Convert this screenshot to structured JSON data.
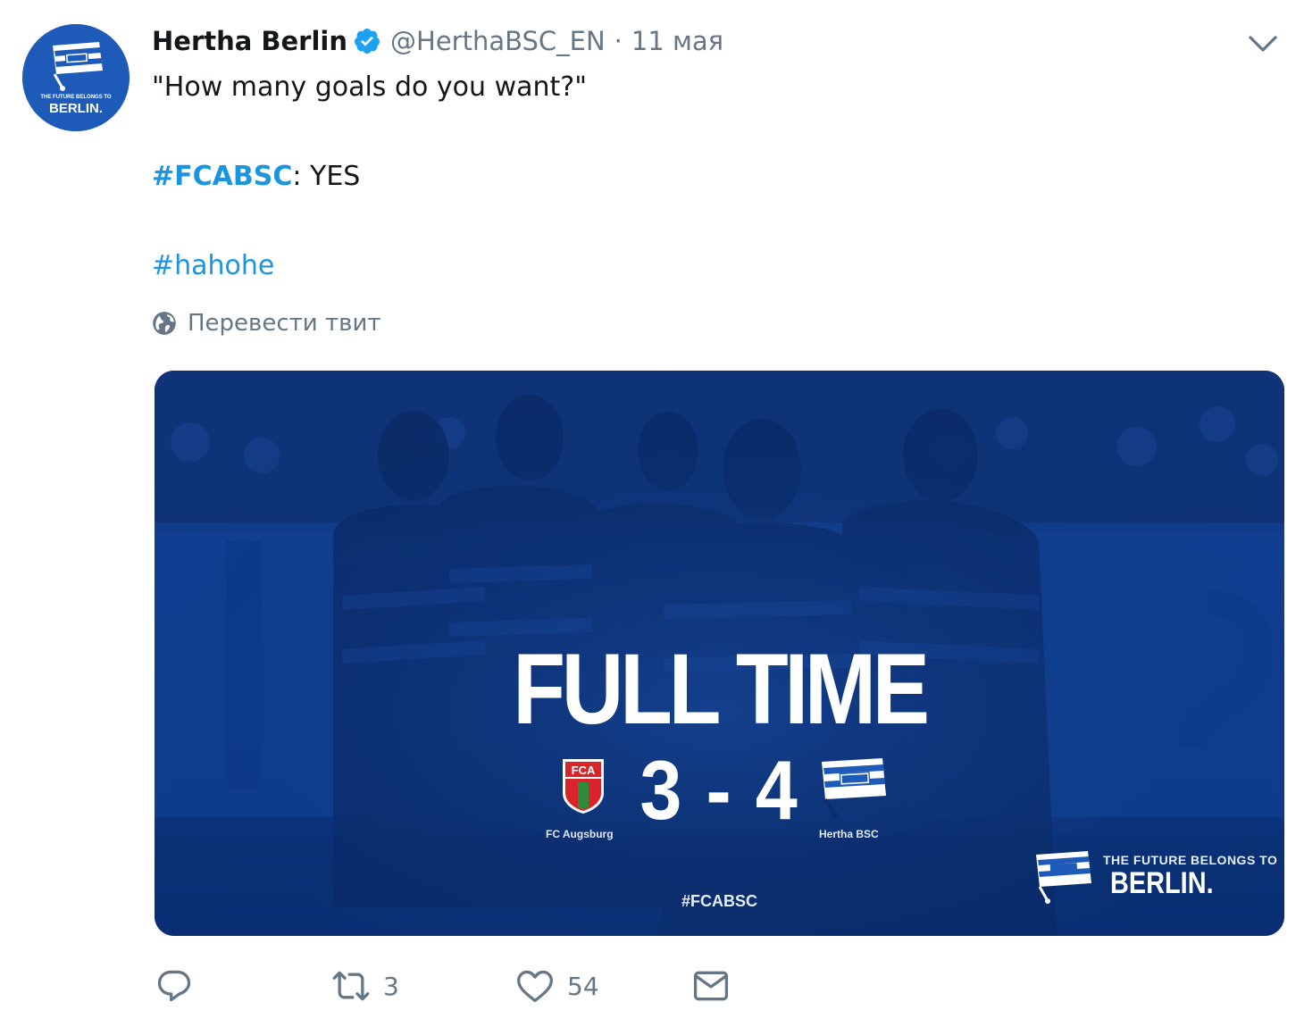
{
  "author": {
    "display_name": "Hertha Berlin",
    "handle": "@HerthaBSC_EN",
    "separator": "·",
    "date": "11 мая",
    "avatar_text_small": "THE FUTURE BELONGS TO",
    "avatar_text_big": "BERLIN."
  },
  "tweet": {
    "line1": "\"How many goals do you want?\"",
    "line2_hashtag": "#FCABSC",
    "line2_rest": ": YES",
    "line3_hashtag": "#hahohe"
  },
  "translate": {
    "label": "Перевести твит"
  },
  "media": {
    "headline": "FULL TIME",
    "home_score": "3",
    "score_separator": "-",
    "away_score": "4",
    "home_team": "FC Augsburg",
    "away_team": "Hertha BSC",
    "home_crest_text": "FCA",
    "hashtag": "#FCABSC",
    "brand_small": "THE FUTURE BELONGS TO",
    "brand_big": "BERLIN."
  },
  "actions": {
    "reply_count": "",
    "retweet_count": "3",
    "like_count": "54"
  },
  "colors": {
    "link": "#1b95e0",
    "secondary_text": "#657786",
    "brand_blue": "#1e5bb8",
    "media_base": "#0b3a86"
  },
  "icons": [
    "verified-icon",
    "chevron-down-icon",
    "globe-icon",
    "reply-icon",
    "retweet-icon",
    "like-icon",
    "direct-message-icon"
  ]
}
